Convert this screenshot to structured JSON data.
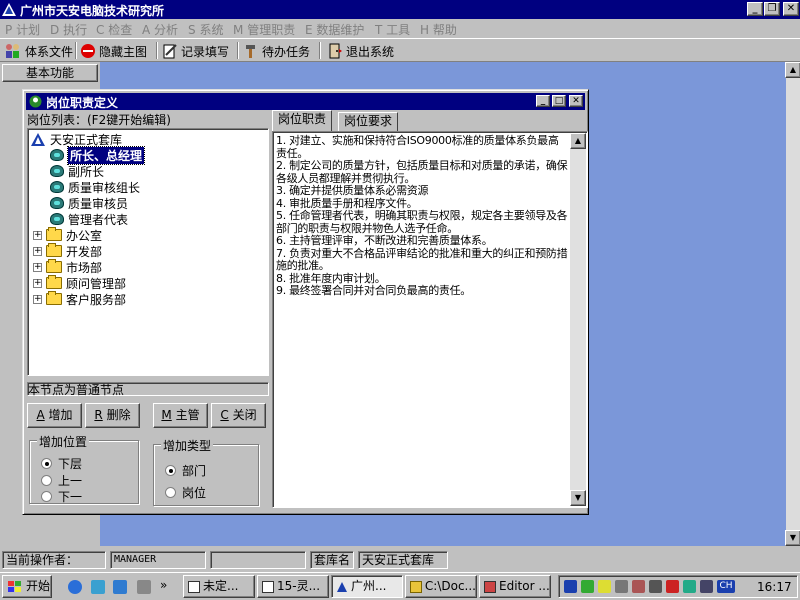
{
  "window": {
    "title": "广州市天安电脑技术研究所",
    "controls": {
      "minimize": "_",
      "maximize": "❐",
      "close": "✕"
    }
  },
  "menu": [
    {
      "key": "P",
      "label": "计划"
    },
    {
      "key": "D",
      "label": "执行"
    },
    {
      "key": "C",
      "label": "检查"
    },
    {
      "key": "A",
      "label": "分析"
    },
    {
      "key": "S",
      "label": "系统"
    },
    {
      "key": "M",
      "label": "管理职责"
    },
    {
      "key": "E",
      "label": "数据维护"
    },
    {
      "key": "T",
      "label": "工具"
    },
    {
      "key": "H",
      "label": "帮助"
    }
  ],
  "toolbar": {
    "system_file": "体系文件",
    "hide_main": "隐藏主图",
    "record_fill": "记录填写",
    "pending_task": "待办任务",
    "exit_system": "退出系统"
  },
  "left_panel": {
    "basic_functions": "基本功能"
  },
  "dialog": {
    "title": "岗位职责定义",
    "list_label": "岗位列表：(F2键开始编辑)",
    "tree": {
      "root": "天安正式套库",
      "positions": [
        "所长、总经理",
        "副所长",
        "质量审核组长",
        "质量审核员",
        "管理者代表"
      ],
      "selected": "所长、总经理",
      "departments": [
        "办公室",
        "开发部",
        "市场部",
        "顾问管理部",
        "客户服务部"
      ]
    },
    "node_info": "本节点为普通节点",
    "buttons": [
      {
        "key": "A",
        "label": "增加"
      },
      {
        "key": "R",
        "label": "删除"
      },
      {
        "key": "M",
        "label": "主管"
      },
      {
        "key": "C",
        "label": "关闭"
      }
    ],
    "add_position": {
      "label": "增加位置",
      "options": [
        "下层",
        "上一",
        "下一"
      ],
      "selected": "下层"
    },
    "add_type": {
      "label": "增加类型",
      "options": [
        "部门",
        "岗位"
      ],
      "selected": "部门"
    },
    "tabs": [
      "岗位职责",
      "岗位要求"
    ],
    "active_tab": "岗位职责",
    "duties": [
      "1. 对建立、实施和保持符合ISO9000标准的质量体系负最高责任。",
      "2. 制定公司的质量方针，包括质量目标和对质量的承诺，确保各级人员都理解并贯彻执行。",
      "3. 确定并提供质量体系必需资源",
      "4. 审批质量手册和程序文件。",
      "5. 任命管理者代表，明确其职责与权限，规定各主要领导及各部门的职责与权限并物色人选予任命。",
      "6. 主持管理评审，不断改进和完善质量体系。",
      "7. 负责对重大不合格品评审结论的批准和重大的纠正和预防措施的批准。",
      "8. 批准年度内审计划。",
      "9. 最终签署合同并对合同负最高的责任。"
    ]
  },
  "status": {
    "operator_label": "当前操作者：",
    "operator_value": "MANAGER",
    "library_label": "套库名",
    "library_value": "天安正式套库"
  },
  "taskbar": {
    "start": "开始",
    "chevron": "»",
    "tasks": [
      "未定...",
      "15-灵...",
      "广州...",
      "C:\\Doc...",
      "Editor ..."
    ],
    "ime": "CH",
    "clock": "16:17"
  }
}
